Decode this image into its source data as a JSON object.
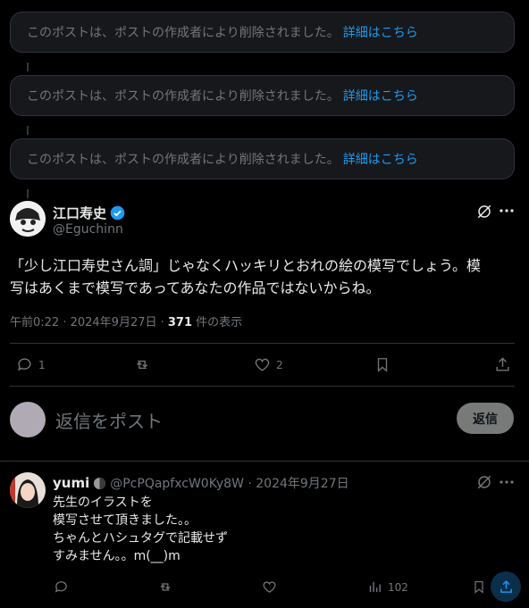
{
  "deleted_posts": [
    {
      "text": "このポストは、ポストの作成者により削除されました。",
      "link": "詳細はこちら"
    },
    {
      "text": "このポストは、ポストの作成者により削除されました。",
      "link": "詳細はこちら"
    },
    {
      "text": "このポストは、ポストの作成者により削除されました。",
      "link": "詳細はこちら"
    }
  ],
  "main_post": {
    "name": "江口寿史",
    "handle": "@Eguchinn",
    "text_line1": "「少し江口寿史さん調」じゃなくハッキリとおれの絵の模写でしょう。模",
    "text_line2": "写はあくまで模写であってあなたの作品ではないからね。",
    "time": "午前0:22 · 2024年9月27日 · ",
    "views": "371",
    "views_label": " 件の表示",
    "reply_count": "1",
    "repost_count": "",
    "like_count": "2"
  },
  "compose": {
    "placeholder": "返信をポスト",
    "button": "返信"
  },
  "reply_post": {
    "name": "yumi",
    "handle_time": "@PcPQapfxcW0Ky8W · 2024年9月27日",
    "lines": [
      "先生のイラストを",
      "模写させて頂きました。。",
      "ちゃんとハシュタグで記載せず",
      "すみません。。m(__)m"
    ],
    "views": "102"
  }
}
